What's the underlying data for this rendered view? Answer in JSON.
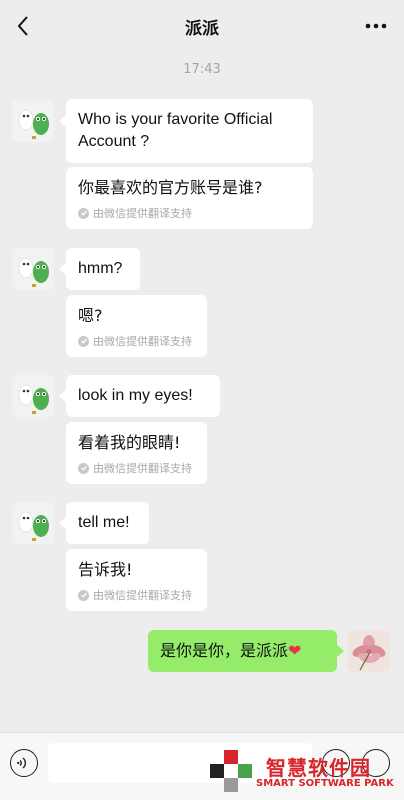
{
  "header": {
    "title": "派派"
  },
  "timestamp": "17:43",
  "messages": [
    {
      "text": "Who is your favorite Official Account ?",
      "text_line1": "Who is your favorite Official",
      "text_line2": "Account ?",
      "translation": "你最喜欢的官方账号是谁?",
      "translation_note": "由微信提供翻译支持"
    },
    {
      "text": "hmm?",
      "translation": "嗯?",
      "translation_note": "由微信提供翻译支持"
    },
    {
      "text": "look in my eyes!",
      "translation": "看着我的眼睛!",
      "translation_note": "由微信提供翻译支持"
    },
    {
      "text": "tell me!",
      "translation": "告诉我!",
      "translation_note": "由微信提供翻译支持"
    }
  ],
  "my_message": {
    "text": "是你是你，是派派",
    "emoji": "❤"
  },
  "watermark": {
    "cn": "智慧软件园",
    "en": "SMART SOFTWARE PARK"
  },
  "colors": {
    "background": "#ededed",
    "my_bubble": "#95ec69",
    "their_bubble": "#ffffff",
    "watermark": "#d7262b"
  },
  "icons": {
    "back": "chevron-left-icon",
    "more": "more-dots-icon",
    "voice": "voice-icon",
    "emoji": "emoji-icon",
    "plus": "plus-icon"
  }
}
